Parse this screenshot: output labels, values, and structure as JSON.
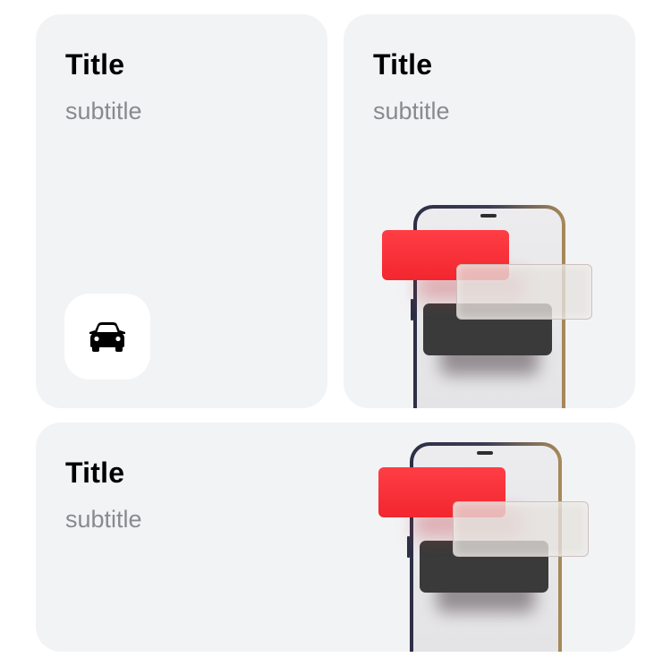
{
  "cards": [
    {
      "title": "Title",
      "subtitle": "subtitle",
      "icon": "car-icon"
    },
    {
      "title": "Title",
      "subtitle": "subtitle",
      "illustration": "phone-notifications-illustration"
    },
    {
      "title": "Title",
      "subtitle": "subtitle",
      "illustration": "phone-notifications-illustration"
    }
  ],
  "colors": {
    "card_background": "#f2f3f5",
    "title": "#000000",
    "subtitle": "#8a8a8e",
    "accent_red": "#f2262f"
  }
}
